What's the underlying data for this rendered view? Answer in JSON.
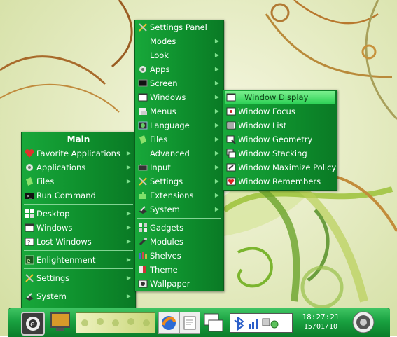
{
  "main_menu": {
    "title": "Main",
    "items": [
      {
        "label": "Favorite Applications",
        "icon": "heart-icon",
        "arrow": true
      },
      {
        "label": "Applications",
        "icon": "gear-icon",
        "arrow": true
      },
      {
        "label": "Files",
        "icon": "folder-icon",
        "arrow": true
      },
      {
        "label": "Run Command",
        "icon": "terminal-icon",
        "arrow": false
      },
      {
        "label": "Desktop",
        "icon": "desktop-grid-icon",
        "arrow": true
      },
      {
        "label": "Windows",
        "icon": "window-icon",
        "arrow": true
      },
      {
        "label": "Lost Windows",
        "icon": "lost-window-icon",
        "arrow": true
      },
      {
        "label": "Enlightenment",
        "icon": "enlightenment-icon",
        "arrow": true
      },
      {
        "label": "Settings",
        "icon": "tools-icon",
        "arrow": true
      },
      {
        "label": "System",
        "icon": "system-icon",
        "arrow": true
      }
    ]
  },
  "settings_menu": {
    "items": [
      {
        "label": "Settings Panel",
        "icon": "tools-icon",
        "arrow": false
      },
      {
        "label": "Modes",
        "icon": "",
        "arrow": true
      },
      {
        "label": "Look",
        "icon": "",
        "arrow": true
      },
      {
        "label": "Apps",
        "icon": "gear-icon",
        "arrow": true
      },
      {
        "label": "Screen",
        "icon": "screen-icon",
        "arrow": true
      },
      {
        "label": "Windows",
        "icon": "window-icon",
        "arrow": true
      },
      {
        "label": "Menus",
        "icon": "menu-icon",
        "arrow": true
      },
      {
        "label": "Language",
        "icon": "language-icon",
        "arrow": true
      },
      {
        "label": "Files",
        "icon": "folder-icon",
        "arrow": true
      },
      {
        "label": "Advanced",
        "icon": "",
        "arrow": true
      },
      {
        "label": "Input",
        "icon": "keyboard-icon",
        "arrow": true
      },
      {
        "label": "Settings",
        "icon": "tools-icon",
        "arrow": true
      },
      {
        "label": "Extensions",
        "icon": "puzzle-icon",
        "arrow": true
      },
      {
        "label": "System",
        "icon": "system-icon",
        "arrow": true
      },
      {
        "label": "Gadgets",
        "icon": "gadgets-icon",
        "arrow": false
      },
      {
        "label": "Modules",
        "icon": "plug-icon",
        "arrow": false
      },
      {
        "label": "Shelves",
        "icon": "books-icon",
        "arrow": false
      },
      {
        "label": "Theme",
        "icon": "theme-icon",
        "arrow": false
      },
      {
        "label": "Wallpaper",
        "icon": "wallpaper-icon",
        "arrow": false
      }
    ]
  },
  "windows_menu": {
    "items": [
      {
        "label": "Window Display",
        "icon": "window-icon",
        "selected": true
      },
      {
        "label": "Window Focus",
        "icon": "window-focus-icon",
        "selected": false
      },
      {
        "label": "Window List",
        "icon": "window-list-icon",
        "selected": false
      },
      {
        "label": "Window Geometry",
        "icon": "window-geometry-icon",
        "selected": false
      },
      {
        "label": "Window Stacking",
        "icon": "window-stacking-icon",
        "selected": false
      },
      {
        "label": "Window Maximize Policy",
        "icon": "window-maximize-icon",
        "selected": false
      },
      {
        "label": "Window Remembers",
        "icon": "window-remember-icon",
        "selected": false
      }
    ]
  },
  "taskbar": {
    "time": "18:27:21",
    "date": "15/01/10"
  },
  "colors": {
    "menu_green": "#12992f",
    "highlight": "#4fe06e",
    "arrow": "#7ee08d"
  }
}
